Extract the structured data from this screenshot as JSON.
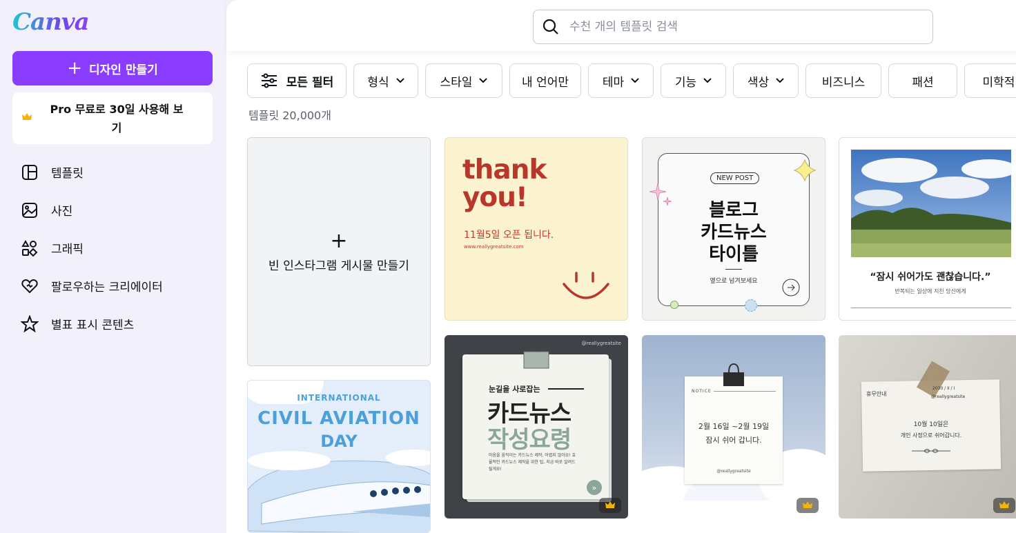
{
  "app": {
    "logo": "Canva"
  },
  "sidebar": {
    "create_label": "디자인 만들기",
    "pro_label": "Pro 무료로 30일 사용해 보기",
    "items": [
      {
        "label": "템플릿",
        "icon": "template-icon"
      },
      {
        "label": "사진",
        "icon": "photo-icon"
      },
      {
        "label": "그래픽",
        "icon": "shapes-icon"
      },
      {
        "label": "팔로우하는 크리에이터",
        "icon": "heart-icon"
      },
      {
        "label": "별표 표시 콘텐츠",
        "icon": "star-icon"
      }
    ]
  },
  "search": {
    "placeholder": "수천 개의 템플릿 검색"
  },
  "filters": {
    "all_label": "모든 필터",
    "chips": [
      "형식",
      "스타일",
      "내 언어만",
      "테마",
      "기능",
      "색상",
      "비즈니스",
      "패션",
      "미학적"
    ]
  },
  "results": {
    "count": "템플릿 20,000개"
  },
  "blank_card": {
    "label": "빈 인스타그램 게시물 만들기"
  },
  "templates": {
    "thankyou": {
      "line1": "thank",
      "line2": "you!",
      "sub": "11월5일 오픈 됩니다.",
      "url": "www.reallygreatsite.com"
    },
    "blog": {
      "badge": "NEW POST",
      "line1": "블로그",
      "line2": "카드뉴스",
      "line3": "타이틀",
      "sub": "옆으로 넘겨보세요"
    },
    "rest": {
      "quote": "“잠시 쉬어가도 괜찮습니다.”",
      "sub": "반복되는 일상에 지친 당신에게"
    },
    "aviation": {
      "line1": "INTERNATIONAL",
      "line2": "CIVIL AVIATION",
      "line3": "DAY"
    },
    "cardnews": {
      "handle": "@reallygreatsite",
      "top": "눈길을 사로잡는",
      "line1": "카드뉴스",
      "line2": "작성요령",
      "body": "마음을 움직이는 카드뉴스 제작, 어렵지 않아요! 효율적인 카드뉴스 제작을 위한 팁, 지금 바로 알려드릴게요!"
    },
    "notice": {
      "label": "NOTICE",
      "line1": "2월 16일 ~2월 19일",
      "line2": "잠시 쉬어 갑니다.",
      "handle": "@reallygreatsite"
    },
    "holiday": {
      "title": "휴무안내",
      "date": "2030 / II / I",
      "handle": "@reallygreatsite",
      "line1": "10월 10일은",
      "line2": "개인 사정으로 쉬어갑니다."
    }
  },
  "colors": {
    "accent": "#8b3dff",
    "sidebar_bg": "#f2f1fb",
    "thankyou_red": "#c0392b"
  }
}
